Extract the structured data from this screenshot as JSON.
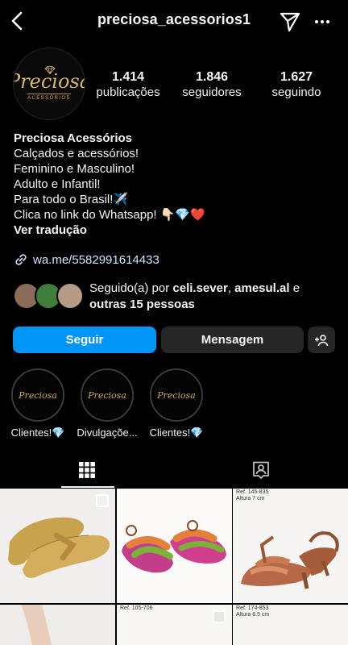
{
  "header": {
    "username": "preciosa_acessorios1"
  },
  "profile": {
    "avatar_logo": "Preciosa",
    "avatar_subtitle": "ACESSÓRIOS",
    "stats": [
      {
        "value": "1.414",
        "label": "publicações"
      },
      {
        "value": "1.846",
        "label": "seguidores"
      },
      {
        "value": "1.627",
        "label": "seguindo"
      }
    ],
    "name": "Preciosa Acessórios",
    "bio_lines": [
      "Calçados e acessórios!",
      "Feminino e Masculino!",
      "Adulto e Infantil!",
      "Para todo o Brasil!✈️",
      "Clica no link do Whatsapp! 👇🏻💎❤️"
    ],
    "translate": "Ver tradução",
    "link": "wa.me/5582991614433",
    "followed_by": {
      "prefix": "Seguido(a) por ",
      "user1": "celi.sever",
      "sep": ", ",
      "user2": "amesul.al",
      "conj": " e",
      "others": "outras 15 pessoas"
    }
  },
  "actions": {
    "follow": "Seguir",
    "message": "Mensagem"
  },
  "highlights": [
    {
      "label": "Clientes!💎",
      "cover": "Preciosa"
    },
    {
      "label": "Divulgaçõe...",
      "cover": "Preciosa"
    },
    {
      "label": "Clientes!💎",
      "cover": "Preciosa"
    }
  ],
  "grid": {
    "posts": [
      {
        "ref": ""
      },
      {
        "ref": ""
      },
      {
        "ref": "Ref. 145-835",
        "size": "Altura 7 cm"
      },
      {
        "ref": ""
      },
      {
        "ref": "Ref. 105-706"
      },
      {
        "ref": "Ref. 174-853",
        "size": "Altura 6.5 cm"
      }
    ]
  },
  "colors": {
    "accent": "#0095f6",
    "background": "#000000",
    "button": "#262626",
    "gold": "#d9b765"
  }
}
